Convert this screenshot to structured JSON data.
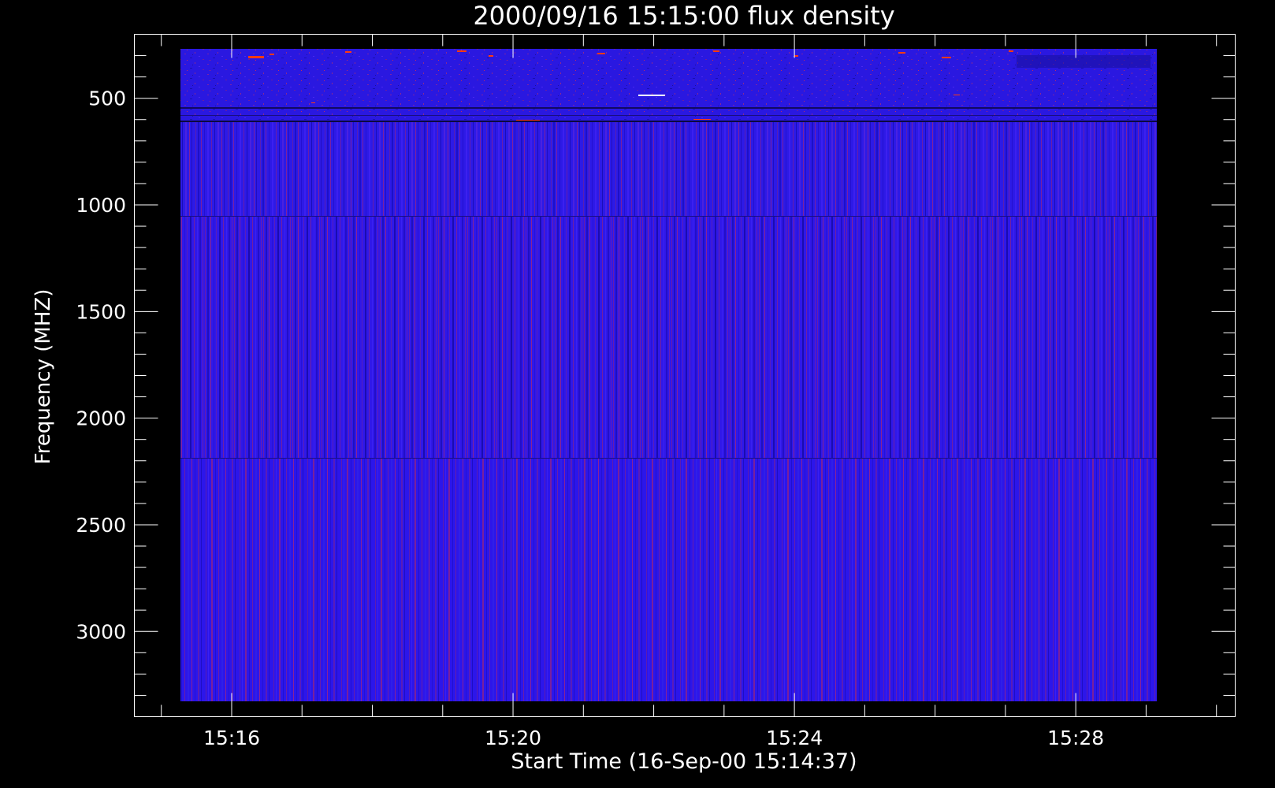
{
  "chart_data": {
    "type": "heatmap",
    "title": "2000/09/16 15:15:00 flux density",
    "xlabel": "Start Time (16-Sep-00 15:14:37)",
    "ylabel": "Frequency (MHZ)",
    "x_range": [
      "15:14:37",
      "15:30:16"
    ],
    "y_range": [
      200,
      3400
    ],
    "y_inverted": true,
    "x_ticks": [
      "15:16",
      "15:20",
      "15:24",
      "15:28"
    ],
    "y_ticks": [
      500,
      1000,
      1500,
      2000,
      2500,
      3000
    ],
    "data_time_range": [
      "15:15:00",
      "15:30:00"
    ],
    "data_freq_range": [
      270,
      3250
    ],
    "bands_mhz": [
      [
        270,
        560
      ],
      [
        560,
        990
      ],
      [
        990,
        2110
      ],
      [
        2110,
        3250
      ]
    ],
    "grid": false,
    "colors": {
      "background": "#000000",
      "foreground": "#ffffff",
      "low": "#1a12d8",
      "mid": "#3a1fe6",
      "high": "#ff3a10"
    }
  }
}
